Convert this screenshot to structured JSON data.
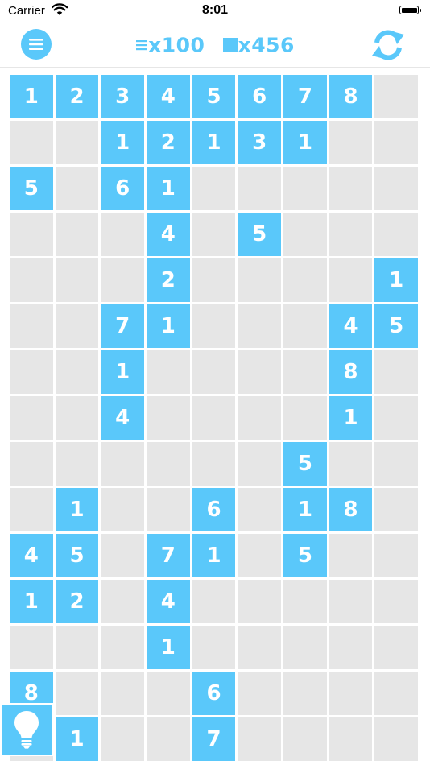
{
  "status_bar": {
    "carrier": "Carrier",
    "time": "8:01"
  },
  "toolbar": {
    "menu_icon": "hamburger-menu-icon",
    "moves_icon": "lines-icon",
    "moves_count": "x100",
    "blocks_icon": "square-icon",
    "blocks_count": "x456",
    "refresh_icon": "refresh-icon"
  },
  "hint_icon": "lightbulb-icon",
  "colors": {
    "accent": "#5ac8fa",
    "empty_cell": "#e6e6e6",
    "background": "#ffffff"
  },
  "board": {
    "columns": 9,
    "rows": [
      [
        "1",
        "2",
        "3",
        "4",
        "5",
        "6",
        "7",
        "8",
        ""
      ],
      [
        "",
        "",
        "1",
        "2",
        "1",
        "3",
        "1",
        "",
        ""
      ],
      [
        "5",
        "",
        "6",
        "1",
        "",
        "",
        "",
        "",
        ""
      ],
      [
        "",
        "",
        "",
        "4",
        "",
        "5",
        "",
        "",
        ""
      ],
      [
        "",
        "",
        "",
        "2",
        "",
        "",
        "",
        "",
        "1"
      ],
      [
        "",
        "",
        "7",
        "1",
        "",
        "",
        "",
        "4",
        "5"
      ],
      [
        "",
        "",
        "1",
        "",
        "",
        "",
        "",
        "8",
        ""
      ],
      [
        "",
        "",
        "4",
        "",
        "",
        "",
        "",
        "1",
        ""
      ],
      [
        "",
        "",
        "",
        "",
        "",
        "",
        "5",
        "",
        ""
      ],
      [
        "",
        "1",
        "",
        "",
        "6",
        "",
        "1",
        "8",
        ""
      ],
      [
        "4",
        "5",
        "",
        "7",
        "1",
        "",
        "5",
        "",
        ""
      ],
      [
        "1",
        "2",
        "",
        "4",
        "",
        "",
        "",
        "",
        ""
      ],
      [
        "",
        "",
        "",
        "1",
        "",
        "",
        "",
        "",
        ""
      ],
      [
        "8",
        "",
        "",
        "",
        "6",
        "",
        "",
        "",
        ""
      ],
      [
        "",
        "1",
        "",
        "",
        "7",
        "",
        "",
        "",
        ""
      ]
    ]
  }
}
